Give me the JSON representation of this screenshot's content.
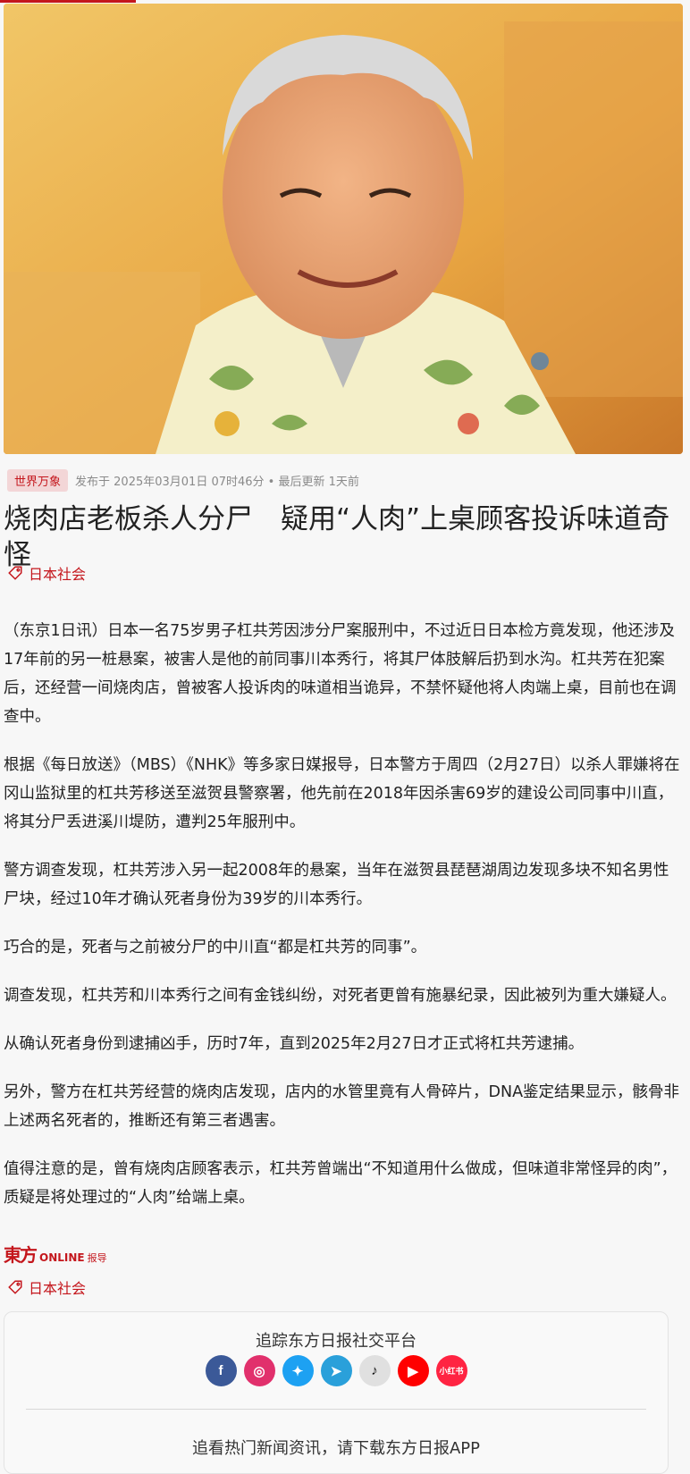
{
  "hero": {
    "image_alt": "杠共芳"
  },
  "meta": {
    "category": "世界万象",
    "published": "发布于 2025年03月01日 07时46分 • 最后更新 1天前"
  },
  "headline": "烧肉店老板杀人分尸　疑用“人肉”上桌顾客投诉味道奇怪",
  "tags": {
    "top": "日本社会",
    "bottom": "日本社会"
  },
  "paragraphs": [
    "（东京1日讯）日本一名75岁男子杠共芳因涉分尸案服刑中，不过近日日本检方竟发现，他还涉及17年前的另一桩悬案，被害人是他的前同事川本秀行，将其尸体肢解后扔到水沟。杠共芳在犯案后，还经营一间烧肉店，曾被客人投诉肉的味道相当诡异，不禁怀疑他将人肉端上桌，目前也在调查中。",
    "根据《每日放送》（MBS）《NHK》等多家日媒报导，日本警方于周四（2月27日）以杀人罪嫌将在冈山监狱里的杠共芳移送至滋贺县警察署，他先前在2018年因杀害69岁的建设公司同事中川直，将其分尸丢进溪川堤防，遭判25年服刑中。",
    "警方调查发现，杠共芳涉入另一起2008年的悬案，当年在滋贺县琵琶湖周边发现多块不知名男性尸块，经过10年才确认死者身份为39岁的川本秀行。",
    "巧合的是，死者与之前被分尸的中川直“都是杠共芳的同事”。",
    "调查发现，杠共芳和川本秀行之间有金钱纠纷，对死者更曾有施暴纪录，因此被列为重大嫌疑人。",
    "从确认死者身份到逮捕凶手，历时7年，直到2025年2月27日才正式将杠共芳逮捕。",
    "另外，警方在杠共芳经营的烧肉店发现，店内的水管里竟有人骨碎片，DNA鉴定结果显示，骸骨非上述两名死者的，推断还有第三者遇害。",
    "值得注意的是，曾有烧肉店顾客表示，杠共芳曾端出“不知道用什么做成，但味道非常怪异的肉”，质疑是将处理过的“人肉”给端上桌。"
  ],
  "source": {
    "logo_main": "東方",
    "logo_online": "ONLINE",
    "logo_suffix": "报导"
  },
  "social": {
    "title": "追踪东方日报社交平台",
    "icons": [
      {
        "name": "facebook-icon",
        "glyph": "f",
        "color": "#3b5998"
      },
      {
        "name": "instagram-icon",
        "glyph": "◎",
        "color": "#e1306c"
      },
      {
        "name": "twitter-icon",
        "glyph": "✦",
        "color": "#1da1f2"
      },
      {
        "name": "telegram-icon",
        "glyph": "➤",
        "color": "#2aa0da"
      },
      {
        "name": "tiktok-icon",
        "glyph": "♪",
        "color": "#e0e0e0"
      },
      {
        "name": "youtube-icon",
        "glyph": "▶",
        "color": "#ff0000"
      },
      {
        "name": "xiaohongshu-icon",
        "glyph": "小红书",
        "color": "#ff2442"
      }
    ],
    "app_prompt": "追看热门新闻资讯，请下载东方日报APP"
  },
  "colors": {
    "accent": "#c4161c",
    "badge_bg": "#f3d6d7",
    "meta_gray": "#8a8a8a"
  }
}
